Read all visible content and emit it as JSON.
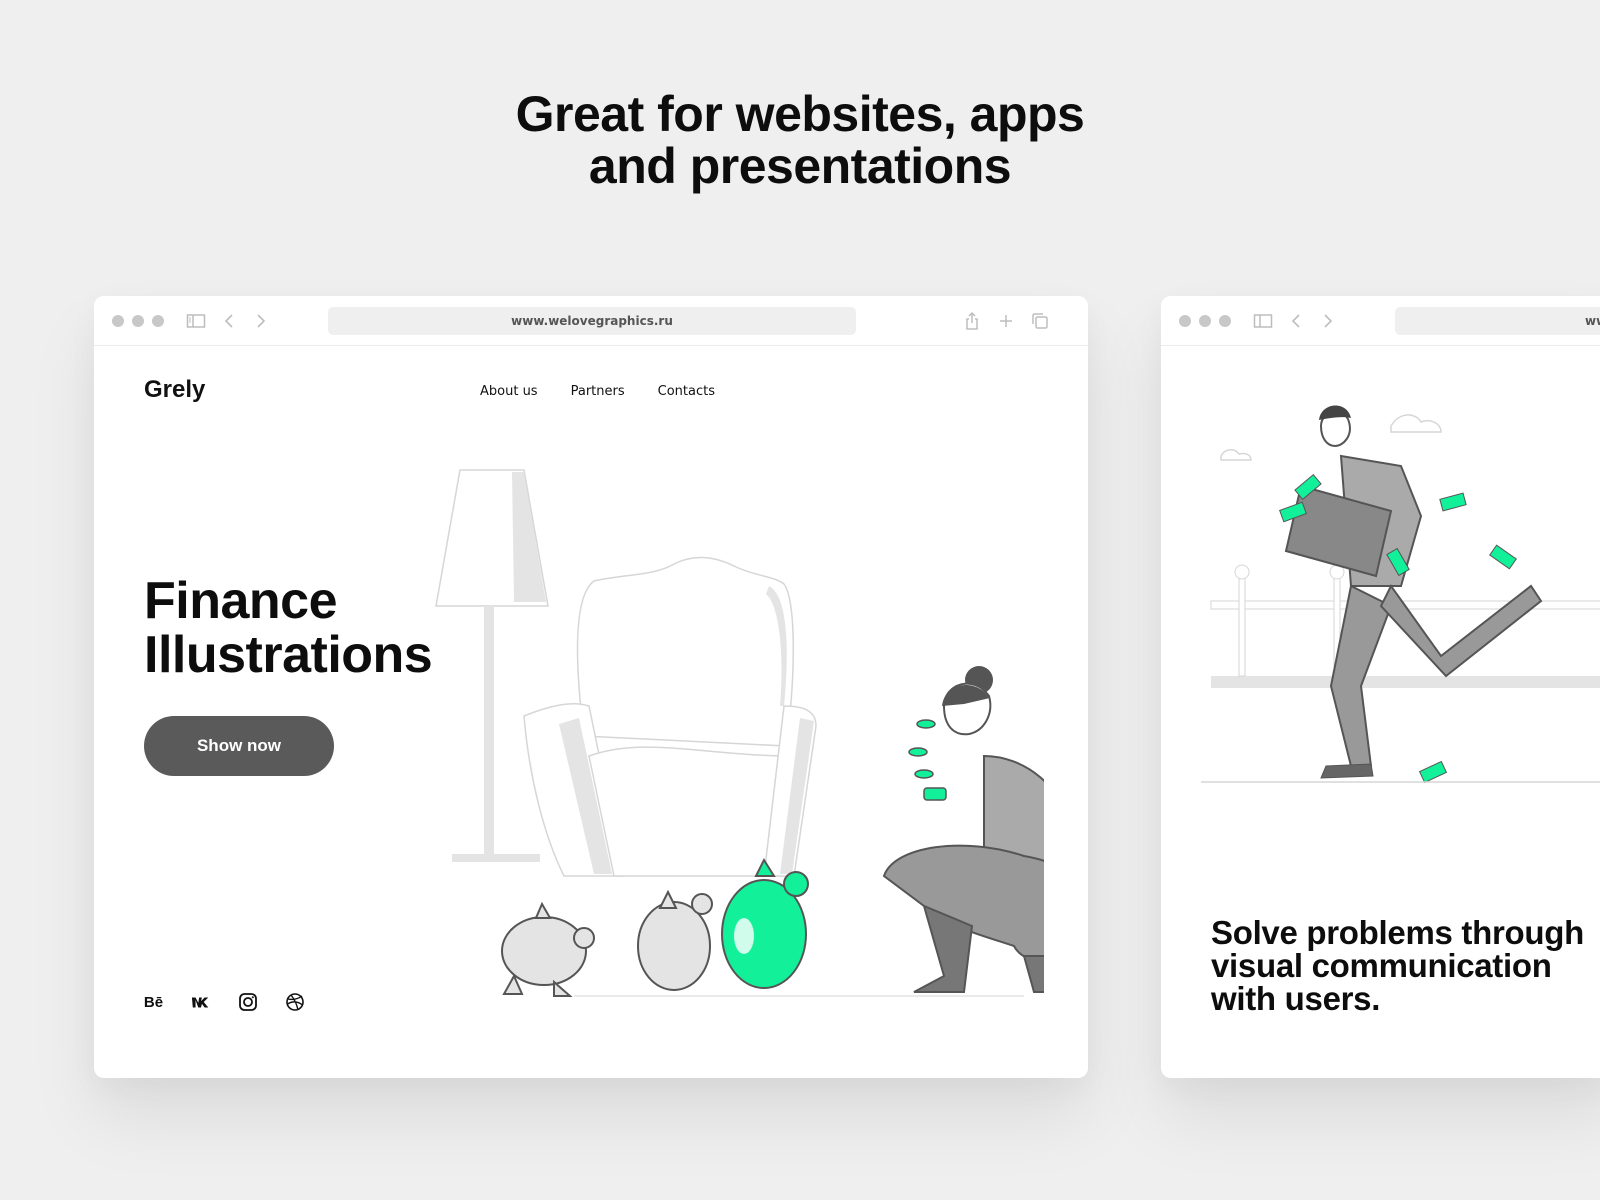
{
  "headline": {
    "line1": "Great for websites, apps",
    "line2": "and presentations"
  },
  "colors": {
    "accent_green": "#12f09a",
    "button_gray": "#5a5a5a",
    "background": "#efefef"
  },
  "browser_main": {
    "url": "www.welovegraphics.ru",
    "toolbar_icons": [
      "sidebar-icon",
      "back-icon",
      "forward-icon",
      "share-icon",
      "new-tab-icon",
      "tabs-icon"
    ],
    "site": {
      "logo": "Grely",
      "nav": [
        "About us",
        "Partners",
        "Contacts"
      ],
      "hero_title_line1": "Finance",
      "hero_title_line2": "Illustrations",
      "cta_label": "Show now",
      "social": {
        "behance": "Bē",
        "vk": "vk-icon",
        "instagram": "instagram-icon",
        "dribbble": "dribbble-icon"
      },
      "illustration": "woman squatting with coins and piggy banks beside armchair and floor lamp"
    }
  },
  "browser_second": {
    "url": "www.welovegraphics.ru",
    "site": {
      "title_line1": "Solve problems through",
      "title_line2": "visual communication",
      "title_line3": "with users.",
      "illustration": "man running with briefcase full of money"
    }
  }
}
